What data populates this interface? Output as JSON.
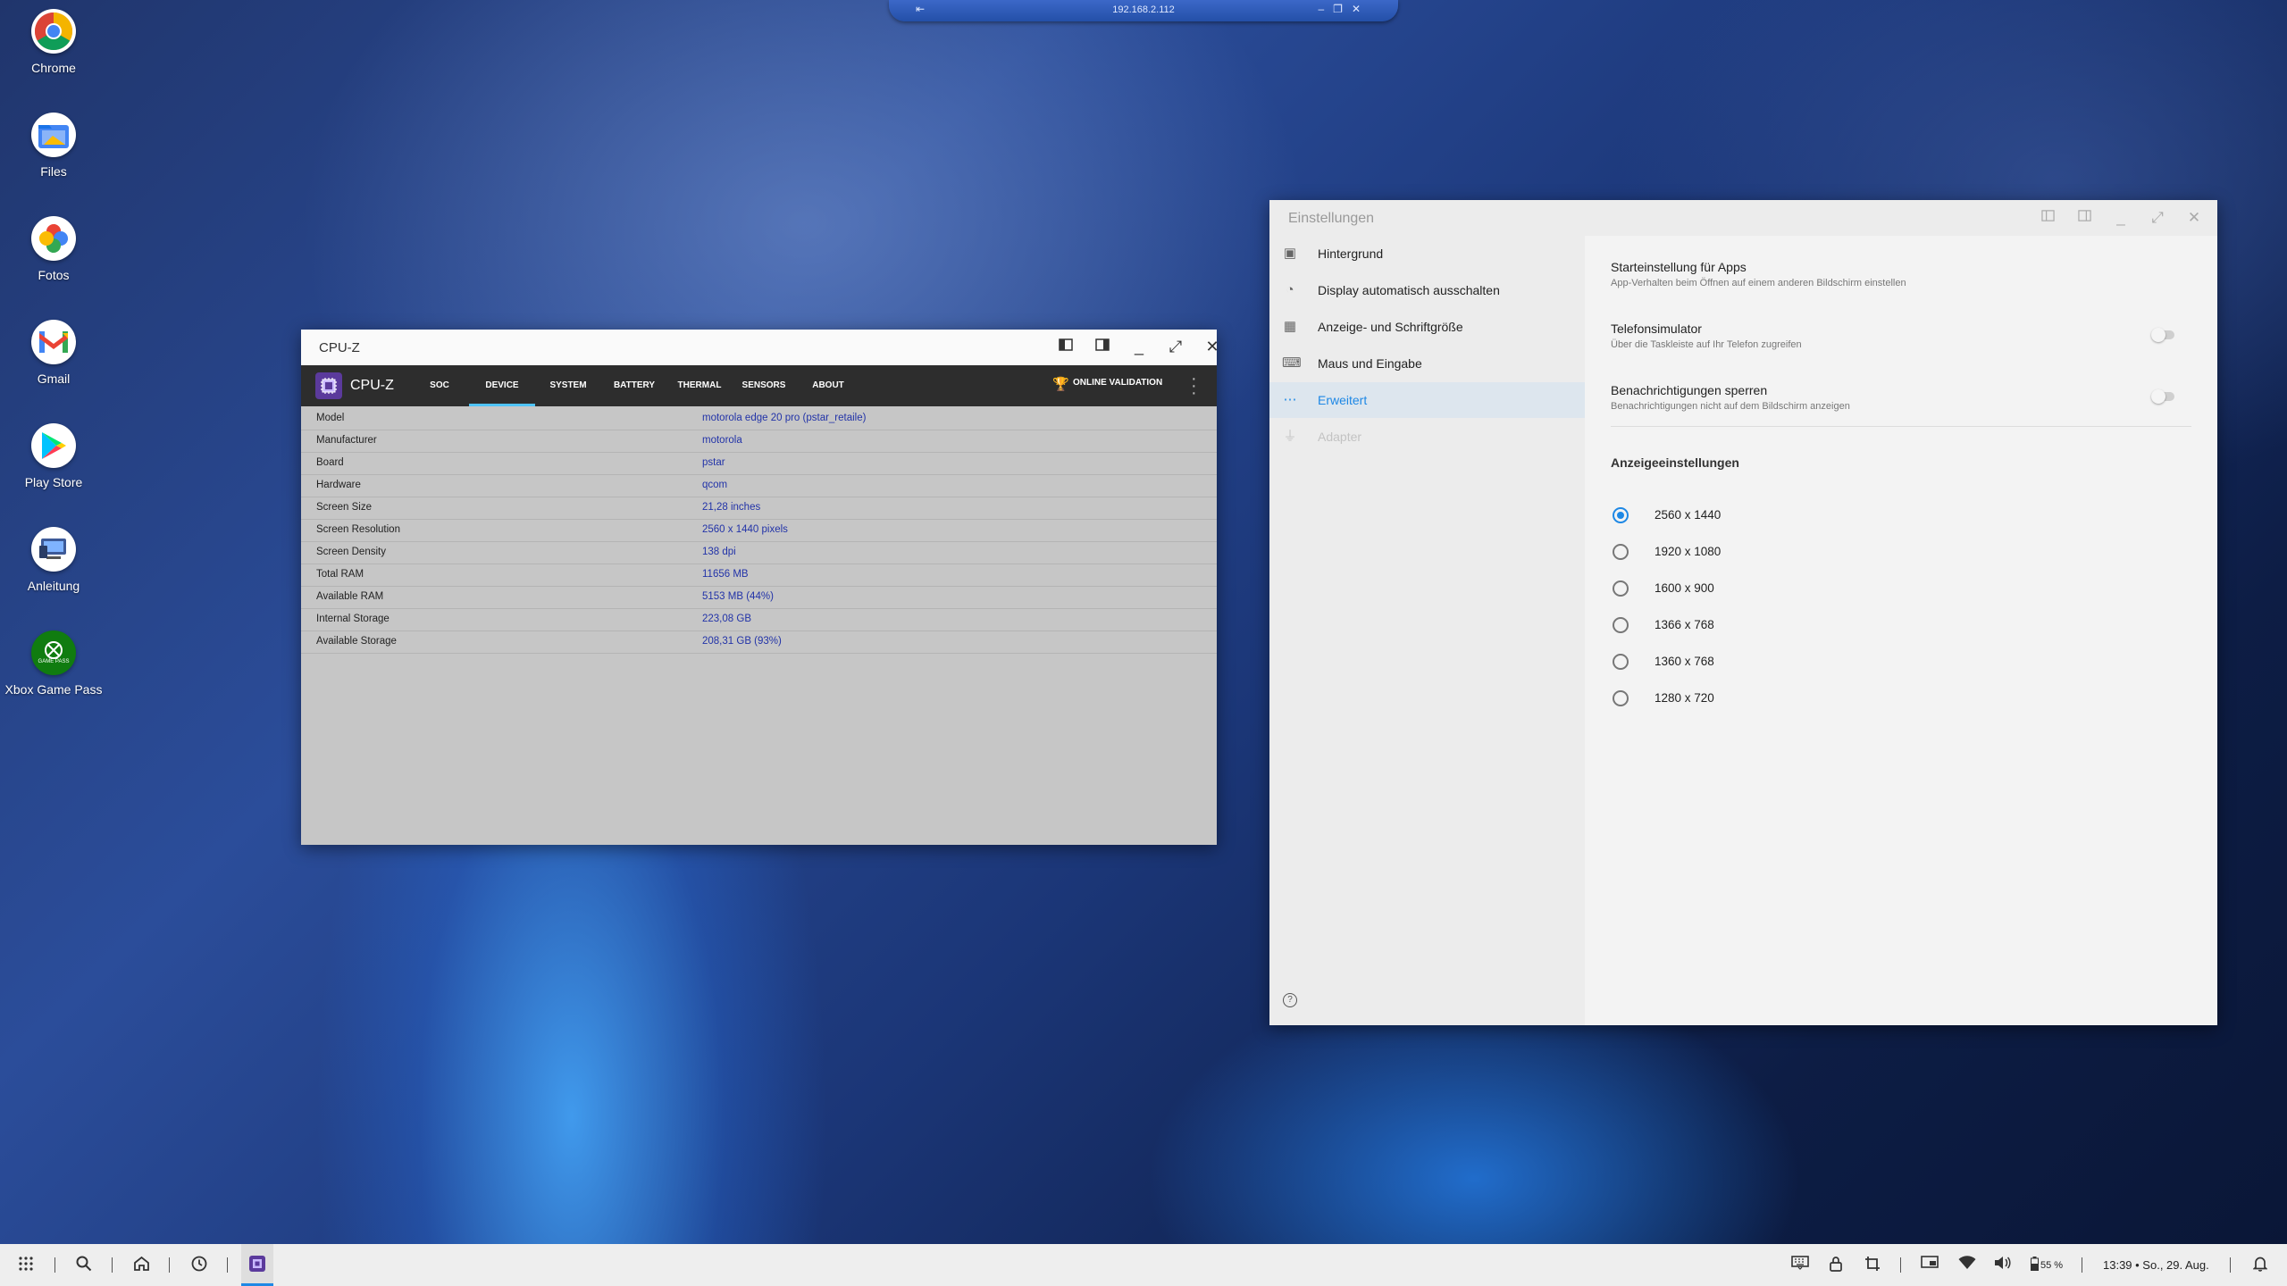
{
  "desktop": {
    "icons": [
      {
        "label": "Chrome",
        "icon": "chrome-icon"
      },
      {
        "label": "Files",
        "icon": "files-icon"
      },
      {
        "label": "Fotos",
        "icon": "photos-icon"
      },
      {
        "label": "Gmail",
        "icon": "gmail-icon"
      },
      {
        "label": "Play Store",
        "icon": "play-store-icon"
      },
      {
        "label": "Anleitung",
        "icon": "guide-icon"
      },
      {
        "label": "Xbox Game Pass",
        "icon": "xbox-game-pass-icon",
        "badge": "GAME PASS"
      }
    ]
  },
  "remote_bar": {
    "address": "192.168.2.112"
  },
  "cpuz": {
    "window_title": "CPU-Z",
    "logo_text": "CPU-Z",
    "tabs": [
      "SOC",
      "DEVICE",
      "SYSTEM",
      "BATTERY",
      "THERMAL",
      "SENSORS",
      "ABOUT"
    ],
    "active_tab": "DEVICE",
    "online_validation": "ONLINE VALIDATION",
    "rows": [
      {
        "key": "Model",
        "value": "motorola edge 20 pro (pstar_retaile)"
      },
      {
        "key": "Manufacturer",
        "value": "motorola"
      },
      {
        "key": "Board",
        "value": "pstar"
      },
      {
        "key": "Hardware",
        "value": "qcom"
      },
      {
        "key": "Screen Size",
        "value": "21,28 inches"
      },
      {
        "key": "Screen Resolution",
        "value": "2560 x 1440 pixels"
      },
      {
        "key": "Screen Density",
        "value": "138 dpi"
      },
      {
        "key": "Total RAM",
        "value": "11656 MB"
      },
      {
        "key": "Available RAM",
        "value": "5153 MB  (44%)"
      },
      {
        "key": "Internal Storage",
        "value": "223,08 GB"
      },
      {
        "key": "Available Storage",
        "value": "208,31 GB (93%)"
      }
    ]
  },
  "settings": {
    "window_title": "Einstellungen",
    "sidebar": [
      {
        "label": "Hintergrund",
        "icon": "wallpaper-icon"
      },
      {
        "label": "Display automatisch ausschalten",
        "icon": "display-timeout-icon"
      },
      {
        "label": "Anzeige- und Schriftgröße",
        "icon": "grid-icon"
      },
      {
        "label": "Maus und Eingabe",
        "icon": "keyboard-icon"
      },
      {
        "label": "Erweitert",
        "icon": "more-dots-icon",
        "active": true
      },
      {
        "label": "Adapter",
        "icon": "usb-icon",
        "disabled": true
      }
    ],
    "options": [
      {
        "title": "Starteinstellung für Apps",
        "subtitle": "App-Verhalten beim Öffnen auf einem anderen Bildschirm einstellen"
      },
      {
        "title": "Telefonsimulator",
        "subtitle": "Über die Taskleiste auf Ihr Telefon zugreifen",
        "toggle": false
      },
      {
        "title": "Benachrichtigungen sperren",
        "subtitle": "Benachrichtigungen nicht auf dem Bildschirm anzeigen",
        "toggle": false
      }
    ],
    "display_section_title": "Anzeigeeinstellungen",
    "resolutions": [
      "2560 x 1440",
      "1920 x 1080",
      "1600 x 900",
      "1366 x 768",
      "1360 x 768",
      "1280 x 720"
    ],
    "selected_resolution": "2560 x 1440",
    "accent_color": "#1e88e5"
  },
  "taskbar": {
    "battery": "55 %",
    "datetime": "13:39 • So., 29. Aug."
  }
}
